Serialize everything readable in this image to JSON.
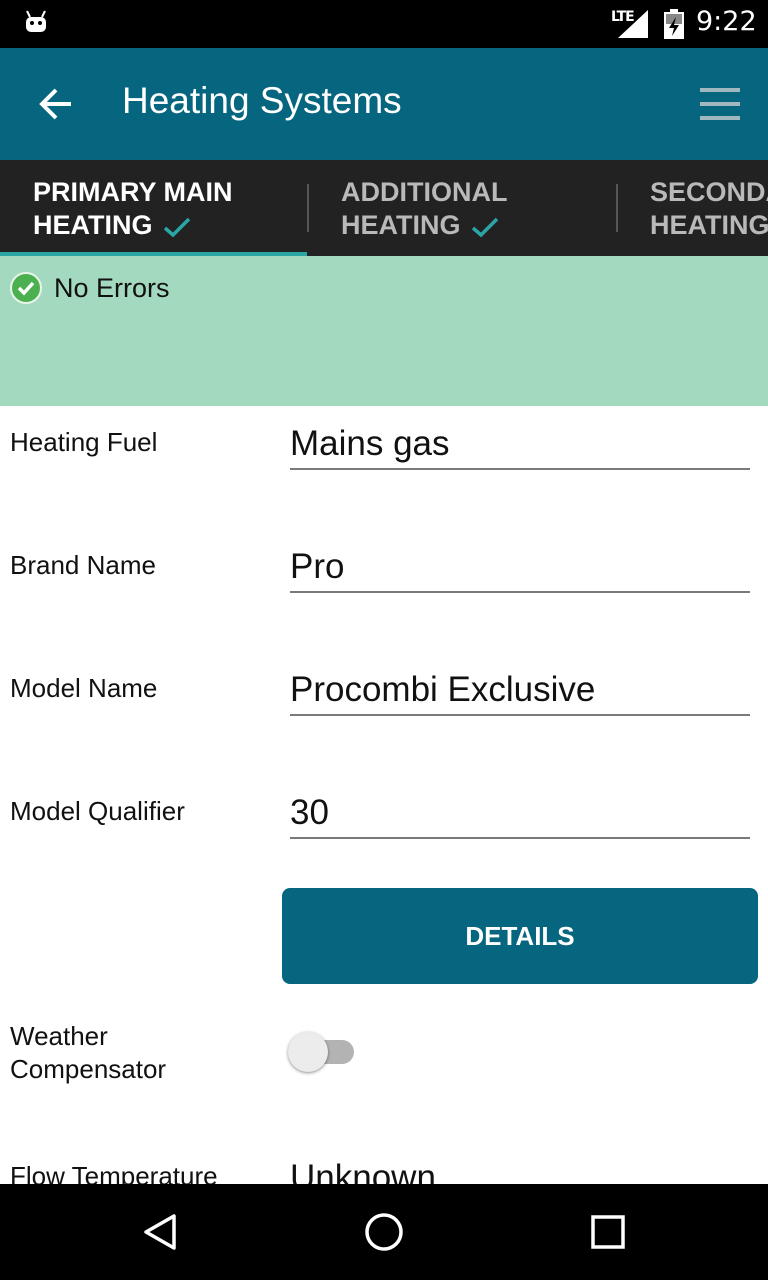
{
  "status_bar": {
    "network": "LTE",
    "time": "9:22"
  },
  "toolbar": {
    "title": "Heating Systems"
  },
  "tabs": [
    {
      "line1": "PRIMARY MAIN",
      "line2": "HEATING",
      "selected": true,
      "complete": true
    },
    {
      "line1": "ADDITIONAL",
      "line2": "HEATING",
      "selected": false,
      "complete": true
    },
    {
      "line1": "SECONDA",
      "line2": "HEATING",
      "selected": false,
      "complete": false
    }
  ],
  "banner": {
    "message": "No Errors",
    "color": "#a3d9be"
  },
  "form": {
    "heating_fuel": {
      "label": "Heating Fuel",
      "value": "Mains gas"
    },
    "brand_name": {
      "label": "Brand Name",
      "value": "Pro"
    },
    "model_name": {
      "label": "Model Name",
      "value": "Procombi Exclusive"
    },
    "model_qualifier": {
      "label": "Model Qualifier",
      "value": "30"
    },
    "details_button": "DETAILS",
    "weather_compensator": {
      "label_line1": "Weather",
      "label_line2": "Compensator",
      "on": false
    },
    "flow_temperature": {
      "label": "Flow Temperature",
      "value": "Unknown"
    }
  },
  "colors": {
    "primary": "#06667f",
    "tab_bar": "#222222",
    "tab_indicator": "#2ba6a6"
  },
  "icons": {
    "status_left": "android-icon",
    "back": "arrow-left-icon",
    "menu": "hamburger-icon",
    "ok": "check-circle-icon",
    "nav_back": "triangle-back-icon",
    "nav_home": "circle-home-icon",
    "nav_recent": "square-recent-icon"
  }
}
